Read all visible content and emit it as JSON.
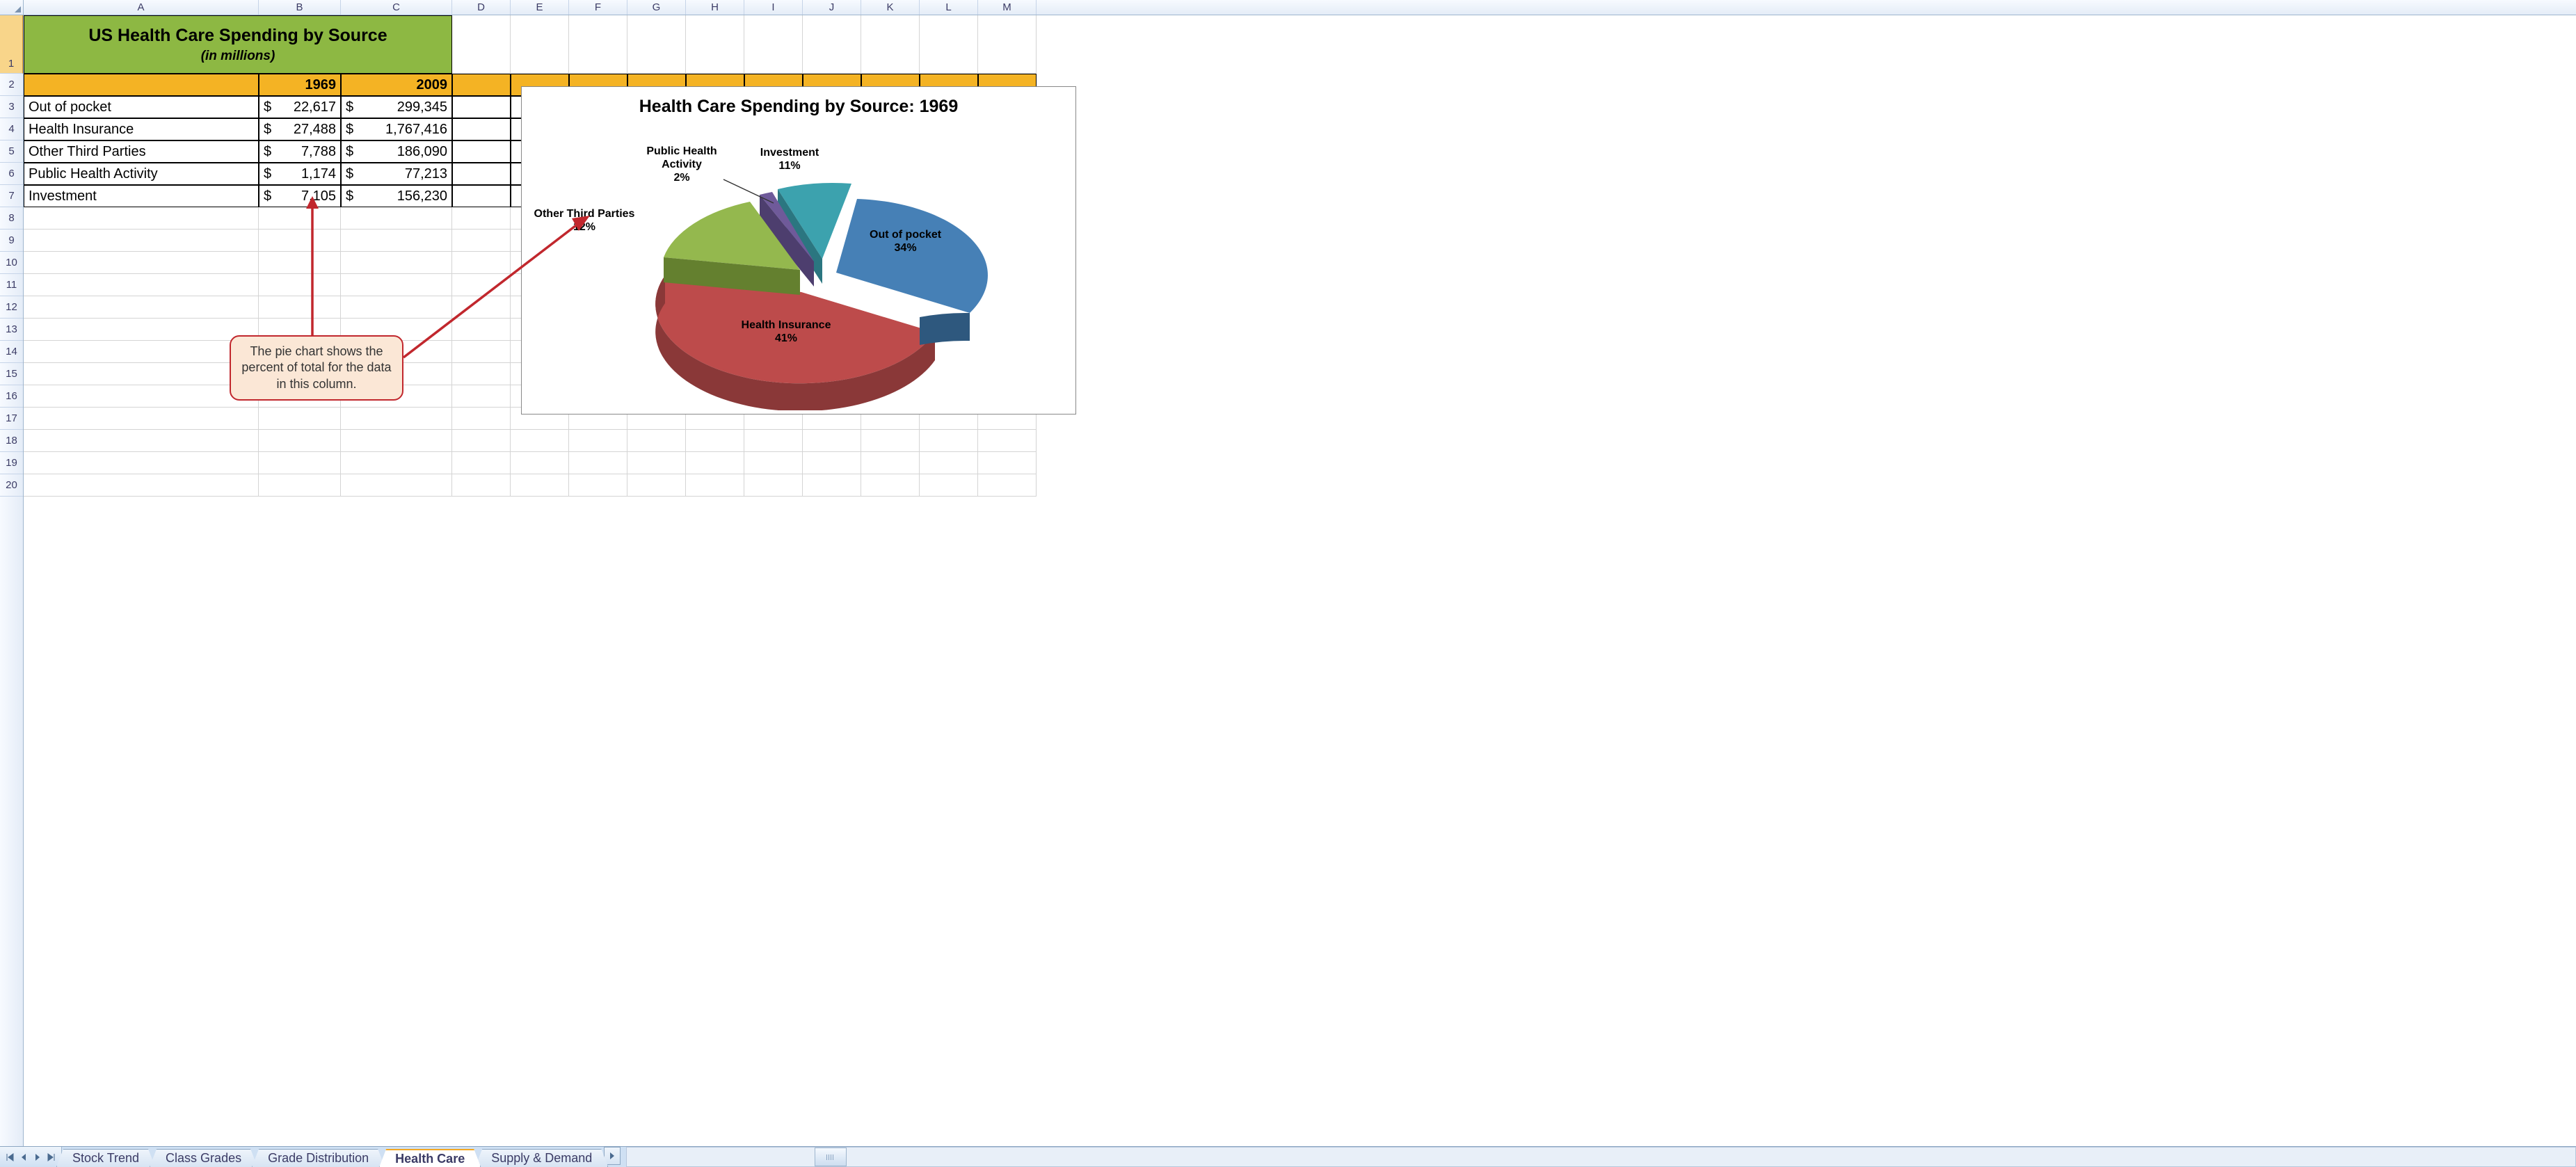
{
  "columns": [
    "A",
    "B",
    "C",
    "D",
    "E",
    "F",
    "G",
    "H",
    "I",
    "J",
    "K",
    "L",
    "M"
  ],
  "col_widths": {
    "A": 338,
    "B": 118,
    "C": 160,
    "D": 84,
    "E": 84,
    "F": 84,
    "G": 84,
    "H": 84,
    "I": 84,
    "J": 84,
    "K": 84,
    "L": 84,
    "M": 84
  },
  "rows_visible": 20,
  "title": {
    "line1": "US Health Care Spending by Source",
    "line2": "(in millions)"
  },
  "headers": {
    "col_b": "1969",
    "col_c": "2009"
  },
  "data_rows": [
    {
      "label": "Out of pocket",
      "b": "22,617",
      "c": "299,345"
    },
    {
      "label": "Health Insurance",
      "b": "27,488",
      "c": "1,767,416"
    },
    {
      "label": "Other Third Parties",
      "b": "7,788",
      "c": "186,090"
    },
    {
      "label": "Public Health Activity",
      "b": "1,174",
      "c": "77,213"
    },
    {
      "label": "Investment",
      "b": "7,105",
      "c": "156,230"
    }
  ],
  "callout_text": "The pie chart shows the percent of total for the data in this column.",
  "chart_data": {
    "type": "pie",
    "title": "Health Care Spending by Source: 1969",
    "categories": [
      "Out of pocket",
      "Health Insurance",
      "Other Third Parties",
      "Public Health Activity",
      "Investment"
    ],
    "values": [
      22617,
      27488,
      7788,
      1174,
      7105
    ],
    "percents": [
      34,
      41,
      12,
      2,
      11
    ],
    "colors": [
      "#4680b6",
      "#bd4b4b",
      "#94b84e",
      "#6f5a9a",
      "#3ca2ae"
    ],
    "labels": [
      {
        "text": "Out of pocket",
        "pct": "34%"
      },
      {
        "text": "Health Insurance",
        "pct": "41%"
      },
      {
        "text": "Other Third Parties",
        "pct": "12%"
      },
      {
        "text": "Public Health Activity",
        "pct": "2%"
      },
      {
        "text": "Investment",
        "pct": "11%"
      }
    ]
  },
  "tabs": [
    {
      "label": "Stock Trend",
      "active": false
    },
    {
      "label": "Class Grades",
      "active": false
    },
    {
      "label": "Grade Distribution",
      "active": false
    },
    {
      "label": "Health Care",
      "active": true
    },
    {
      "label": "Supply & Demand",
      "active": false
    }
  ]
}
